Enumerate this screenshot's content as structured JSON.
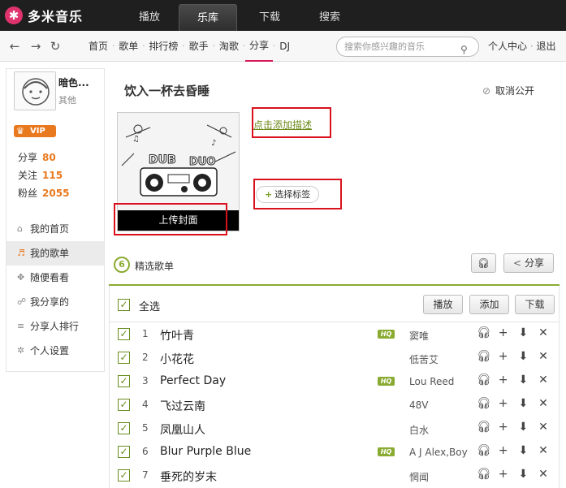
{
  "app": {
    "logo_mark": "✱",
    "name": "多米音乐"
  },
  "nav": {
    "tabs": [
      "播放",
      "乐库",
      "下载",
      "搜索"
    ],
    "active": "乐库"
  },
  "toolbar": {
    "back_icon": "←",
    "forward_icon": "→",
    "refresh_icon": "↻",
    "crumbs": [
      "首页",
      "歌单",
      "排行榜",
      "歌手",
      "淘歌",
      "分享",
      "DJ"
    ],
    "active_crumb": "分享",
    "search_placeholder": "搜索你感兴趣的音乐",
    "user_center": "个人中心",
    "logout": "退出"
  },
  "sidebar": {
    "user_name": "暗色...",
    "user_group": "其他",
    "vip": "VIP",
    "stats": [
      {
        "label": "分享",
        "value": "80"
      },
      {
        "label": "关注",
        "value": "115"
      },
      {
        "label": "粉丝",
        "value": "2055"
      }
    ],
    "menu": [
      {
        "label": "我的首页",
        "icon": "home-icon",
        "glyph": "⌂"
      },
      {
        "label": "我的歌单",
        "icon": "playlist-icon",
        "glyph": "♬"
      },
      {
        "label": "随便看看",
        "icon": "browse-icon",
        "glyph": "✥"
      },
      {
        "label": "我分享的",
        "icon": "share-icon",
        "glyph": "☍"
      },
      {
        "label": "分享人排行",
        "icon": "ranking-icon",
        "glyph": "≡"
      },
      {
        "label": "个人设置",
        "icon": "settings-icon",
        "glyph": "✲"
      }
    ],
    "active": "我的歌单"
  },
  "playlist": {
    "title": "饮入一杯去昏睡",
    "unpublish": "取消公开",
    "upload_cover": "上传封面",
    "add_desc": "点击添加描述",
    "select_tags": "选择标签",
    "featured": "精选歌单",
    "share": "分享"
  },
  "list": {
    "select_all": "全选",
    "play": "播放",
    "add": "添加",
    "download": "下载",
    "hq_label": "HQ",
    "tracks": [
      {
        "n": "1",
        "title": "竹叶青",
        "artist": "窦唯",
        "hq": true
      },
      {
        "n": "2",
        "title": "小花花",
        "artist": "低苦艾",
        "hq": false
      },
      {
        "n": "3",
        "title": "Perfect Day",
        "artist": "Lou Reed",
        "hq": true
      },
      {
        "n": "4",
        "title": "飞过云南",
        "artist": "48V",
        "hq": false
      },
      {
        "n": "5",
        "title": "凤凰山人",
        "artist": "白水",
        "hq": false
      },
      {
        "n": "6",
        "title": "Blur Purple Blue",
        "artist": "A J Alex,Boy",
        "hq": true
      },
      {
        "n": "7",
        "title": "垂死的岁末",
        "artist": "惘闻",
        "hq": false
      }
    ]
  },
  "colors": {
    "accent": "#d61b5c",
    "green": "#8aab33",
    "orange": "#e9791e",
    "highlight_box": "#d9111e"
  }
}
